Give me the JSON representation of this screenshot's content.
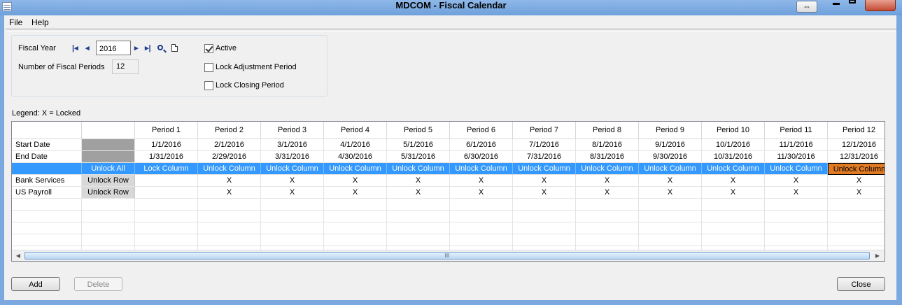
{
  "window": {
    "title": "MDCOM - Fiscal Calendar",
    "restore_glyph": "⇔"
  },
  "menu": {
    "items": [
      "File",
      "Help"
    ]
  },
  "form": {
    "fiscal_year_label": "Fiscal Year",
    "fiscal_year_value": "2016",
    "periods_label": "Number of Fiscal Periods",
    "periods_value": "12",
    "nav": {
      "first": "|◂",
      "prev": "◂",
      "next": "▸",
      "last": "▸|"
    },
    "active": {
      "label": "Active",
      "checked": true
    },
    "lock_adjustment": {
      "label": "Lock Adjustment Period",
      "checked": false
    },
    "lock_closing": {
      "label": "Lock Closing Period",
      "checked": false
    }
  },
  "legend": "Legend: X = Locked",
  "grid": {
    "periods": [
      "Period 1",
      "Period 2",
      "Period 3",
      "Period 4",
      "Period 5",
      "Period 6",
      "Period 7",
      "Period 8",
      "Period 9",
      "Period 10",
      "Period 11",
      "Period 12"
    ],
    "start_label": "Start Date",
    "start_dates": [
      "1/1/2016",
      "2/1/2016",
      "3/1/2016",
      "4/1/2016",
      "5/1/2016",
      "6/1/2016",
      "7/1/2016",
      "8/1/2016",
      "9/1/2016",
      "10/1/2016",
      "11/1/2016",
      "12/1/2016"
    ],
    "end_label": "End Date",
    "end_dates": [
      "1/31/2016",
      "2/29/2016",
      "3/31/2016",
      "4/30/2016",
      "5/31/2016",
      "6/30/2016",
      "7/31/2016",
      "8/31/2016",
      "9/30/2016",
      "10/31/2016",
      "11/30/2016",
      "12/31/2016"
    ],
    "unlock_all_label": "Unlock All",
    "column_actions": [
      "Lock Column",
      "Unlock Column",
      "Unlock Column",
      "Unlock Column",
      "Unlock Column",
      "Unlock Column",
      "Unlock Column",
      "Unlock Column",
      "Unlock Column",
      "Unlock Column",
      "Unlock Column",
      "Unlock Column"
    ],
    "rows": [
      {
        "name": "Bank Services",
        "action": "Unlock Row",
        "cells": [
          "",
          "X",
          "X",
          "X",
          "X",
          "X",
          "X",
          "X",
          "X",
          "X",
          "X",
          "X"
        ]
      },
      {
        "name": "US Payroll",
        "action": "Unlock Row",
        "cells": [
          "",
          "X",
          "X",
          "X",
          "X",
          "X",
          "X",
          "X",
          "X",
          "X",
          "X",
          "X"
        ]
      }
    ],
    "scroll_thumb_grip": "III",
    "scroll_left": "◀",
    "scroll_right": "▶"
  },
  "buttons": {
    "add": "Add",
    "delete": "Delete",
    "close": "Close"
  },
  "colors": {
    "selected_row": "#3399ff",
    "highlighted_cell": "#e07b24"
  }
}
